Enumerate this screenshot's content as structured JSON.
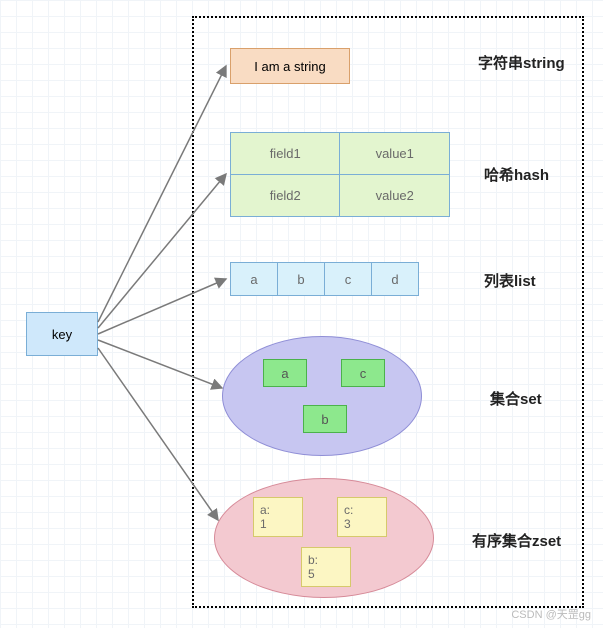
{
  "key": {
    "label": "key"
  },
  "types": {
    "string": {
      "label": "字符串string",
      "value": "I am a string"
    },
    "hash": {
      "label": "哈希hash",
      "rows": [
        {
          "field": "field1",
          "value": "value1"
        },
        {
          "field": "field2",
          "value": "value2"
        }
      ]
    },
    "list": {
      "label": "列表list",
      "items": [
        "a",
        "b",
        "c",
        "d"
      ]
    },
    "set": {
      "label": "集合set",
      "members": [
        "a",
        "c",
        "b"
      ]
    },
    "zset": {
      "label": "有序集合zset",
      "members": [
        {
          "member": "a:",
          "score": "1"
        },
        {
          "member": "c:",
          "score": "3"
        },
        {
          "member": "b:",
          "score": "5"
        }
      ]
    }
  },
  "watermark": "CSDN @天罡gg"
}
